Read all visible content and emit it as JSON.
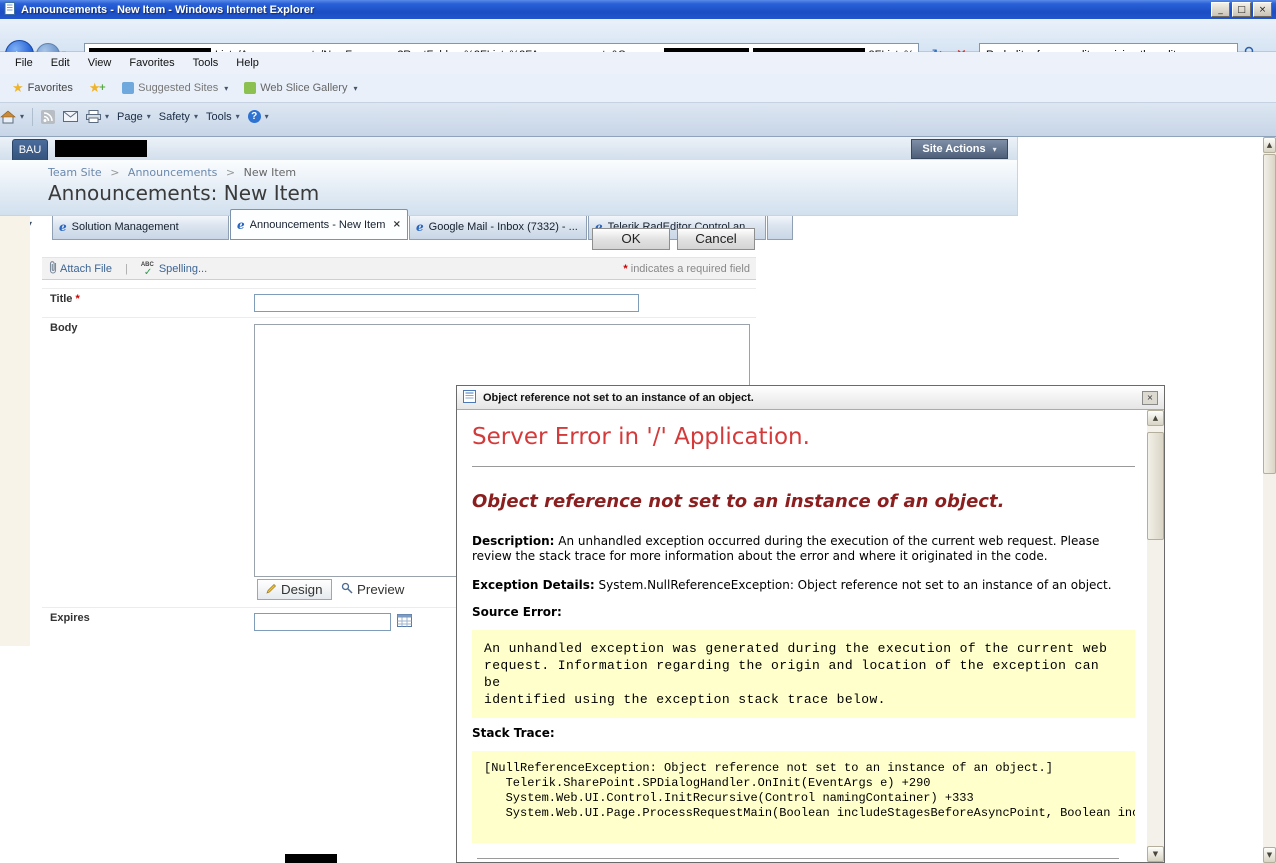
{
  "glyphs": {
    "dropdown": "▾",
    "close": "×",
    "minimize": "_",
    "maximize": "□",
    "back_arrow": "←",
    "forward_arrow": "→",
    "refresh": "↻",
    "pipe": "|",
    "breadcrumb_sep": ">",
    "asterisk": "*",
    "star": "★",
    "plus": "+",
    "check": "✓",
    "up_arrow": "▲",
    "down_arrow": "▼",
    "ie_favicon": "e"
  },
  "window": {
    "title": "Announcements - New Item - Windows Internet Explorer"
  },
  "address_bar": {
    "url_part1": "Lists/Announcements/NewForm.aspx?RootFolder=%2FLists%2FAnnouncements&Source=",
    "url_part2": "2FLists%",
    "search_query": "Radeditor for moss lite resizing the editor"
  },
  "menu_bar": {
    "items": [
      "File",
      "Edit",
      "View",
      "Favorites",
      "Tools",
      "Help"
    ]
  },
  "favorites_bar": {
    "favorites": "Favorites",
    "suggested_sites": "Suggested Sites",
    "web_slice_gallery": "Web Slice Gallery"
  },
  "tabs": [
    {
      "label": "Solution Management"
    },
    {
      "label": "Announcements - New Item"
    },
    {
      "label": "Google Mail - Inbox (7332) - ..."
    },
    {
      "label": "Telerik RadEditor Control an..."
    }
  ],
  "command_bar": {
    "page": "Page",
    "safety": "Safety",
    "tools": "Tools",
    "help": "?"
  },
  "sharepoint": {
    "bau_tab": "BAU",
    "site_actions": "Site Actions",
    "breadcrumb": {
      "level1": "Team Site",
      "level2": "Announcements",
      "level3": "New Item"
    },
    "page_title": "Announcements: New Item",
    "ok": "OK",
    "cancel": "Cancel",
    "attach_file": "Attach File",
    "spelling": "Spelling...",
    "spell_icon_text": "ABC",
    "required_note": "indicates a required field",
    "title_label": "Title",
    "body_label": "Body",
    "expires_label": "Expires",
    "design": "Design",
    "preview": "Preview"
  },
  "error_dialog": {
    "title": "Object reference not set to an instance of an object.",
    "heading": "Server Error in '/' Application.",
    "subheading": "Object reference not set to an instance of an object.",
    "description_label": "Description:",
    "description_text": "An unhandled exception occurred during the execution of the current web request. Please review the stack trace for more information about the error and where it originated in the code.",
    "exception_label": "Exception Details:",
    "exception_text": "System.NullReferenceException: Object reference not set to an instance of an object.",
    "source_error_label": "Source Error:",
    "source_error_text": "An unhandled exception was generated during the execution of the current web\nrequest. Information regarding the origin and location of the exception can be\nidentified using the exception stack trace below.",
    "stack_trace_label": "Stack Trace:",
    "stack_trace_text": "[NullReferenceException: Object reference not set to an instance of an object.]\n   Telerik.SharePoint.SPDialogHandler.OnInit(EventArgs e) +290\n   System.Web.UI.Control.InitRecursive(Control namingContainer) +333\n   System.Web.UI.Page.ProcessRequestMain(Boolean includeStagesBeforeAsyncPoint, Boolean includeSt"
  },
  "colors": {
    "titlebar_blue": "#1b4dc4",
    "error_heading_red": "#d43a3a",
    "error_subheading_maroon": "#8b1f1f",
    "code_box_yellow": "#ffffcc",
    "link_blue": "#3c6595"
  }
}
